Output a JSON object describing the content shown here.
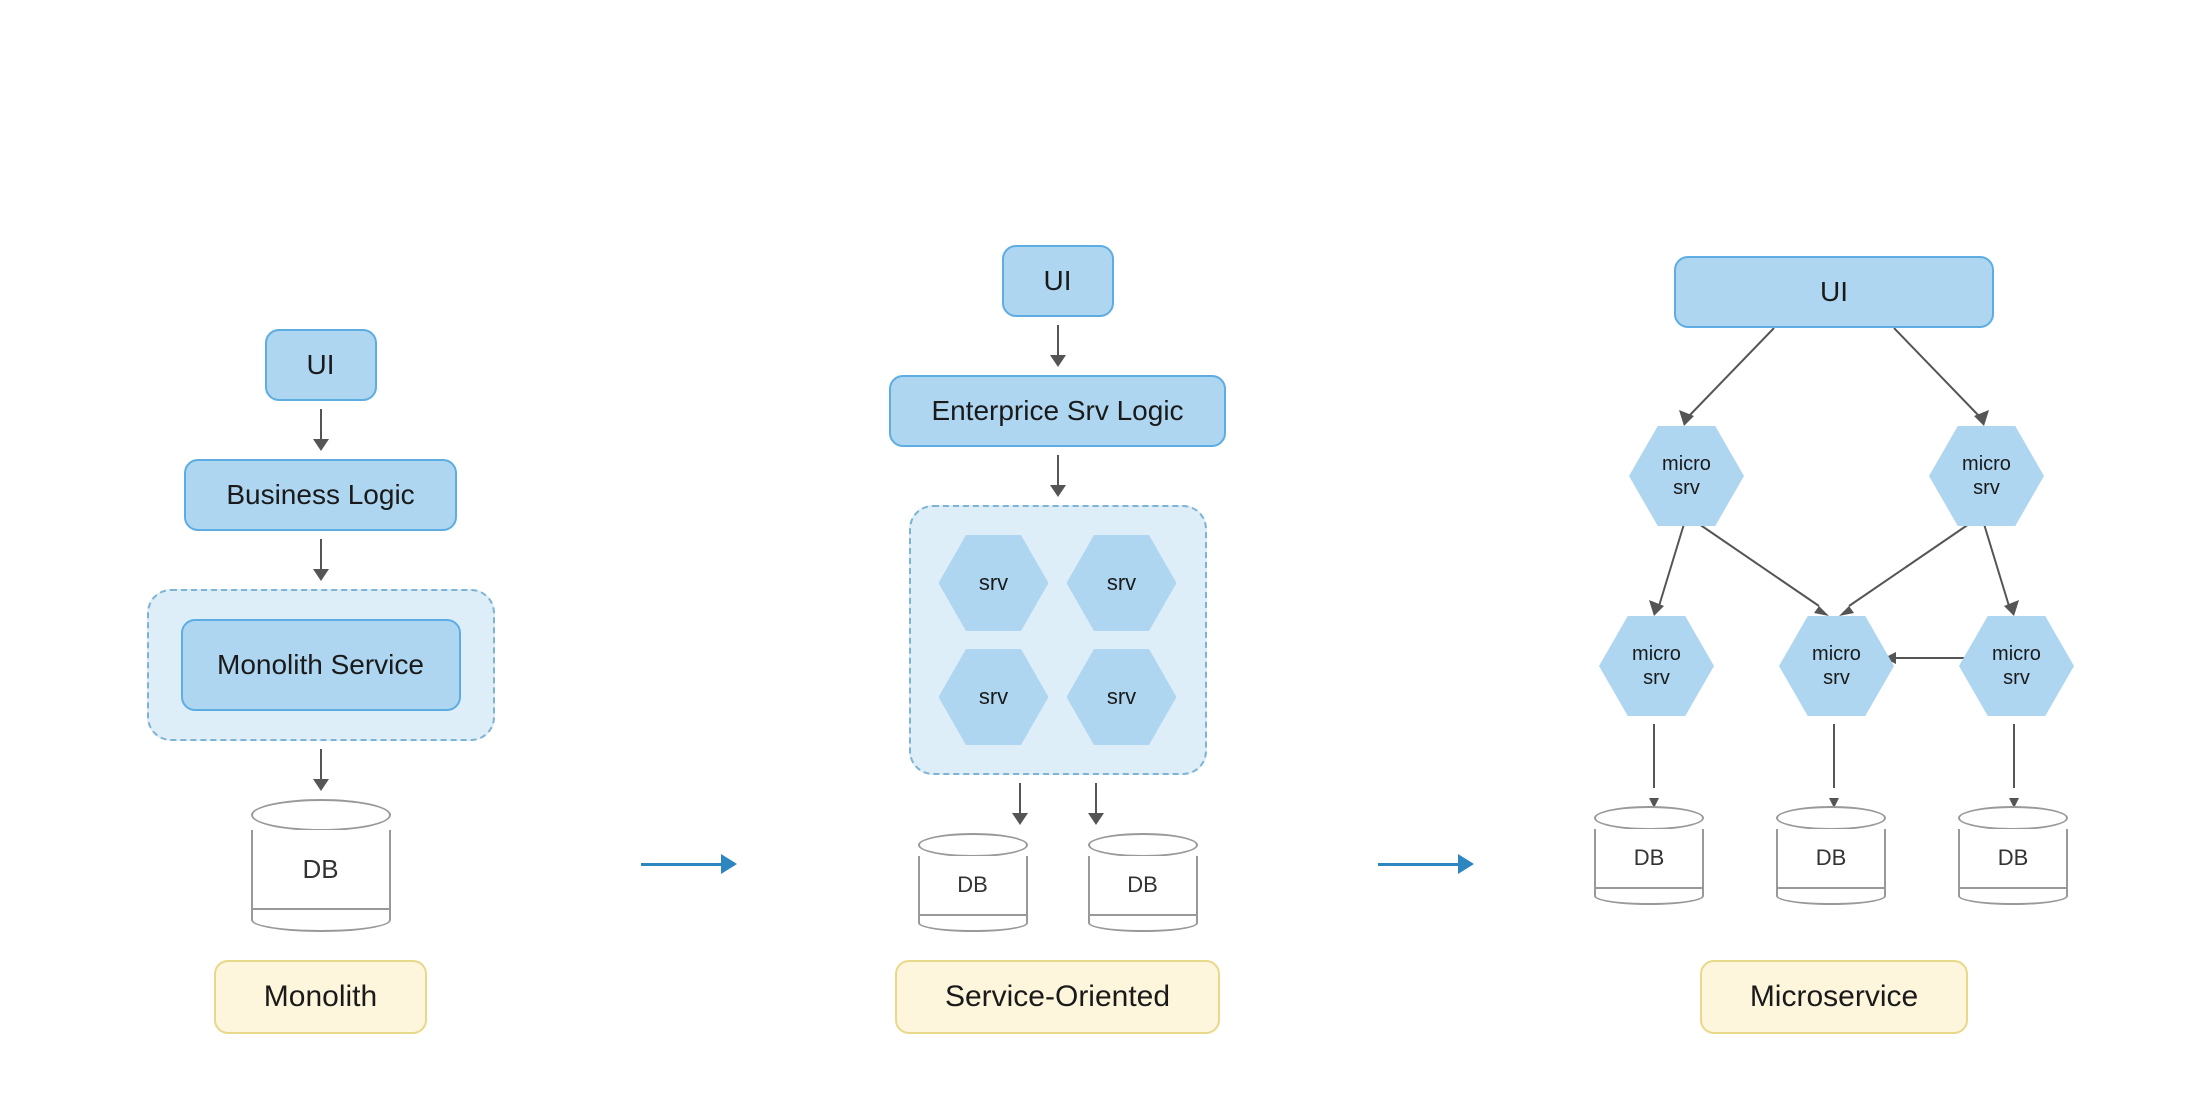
{
  "columns": [
    {
      "id": "monolith",
      "ui_label": "UI",
      "logic_label": "Business Logic",
      "service_label": "Monolith Service",
      "db_label": "DB",
      "arch_label": "Monolith",
      "type": "monolith"
    },
    {
      "id": "soa",
      "ui_label": "UI",
      "logic_label": "Enterprice Srv Logic",
      "srvs": [
        "srv",
        "srv",
        "srv",
        "srv"
      ],
      "dbs": [
        "DB",
        "DB"
      ],
      "arch_label": "Service-Oriented",
      "type": "soa"
    },
    {
      "id": "microservice",
      "ui_label": "UI",
      "top_micros": [
        "micro\nsrv",
        "micro\nsrv"
      ],
      "mid_micros": [
        "micro\nsrv",
        "micro\nsrv",
        "micro\nsrv"
      ],
      "dbs": [
        "DB",
        "DB",
        "DB"
      ],
      "arch_label": "Microservice",
      "type": "microservice"
    }
  ],
  "arrows": [
    "→",
    "→"
  ],
  "colors": {
    "blue_box_bg": "#aed6f1",
    "blue_box_border": "#5dade2",
    "dashed_bg": "#ddeef8",
    "dashed_border": "#7fb3d3",
    "label_bg": "#fdf5dc",
    "label_border": "#e8d88a",
    "arrow_color": "#2e86c1",
    "hex_bg": "#aed6f1"
  }
}
